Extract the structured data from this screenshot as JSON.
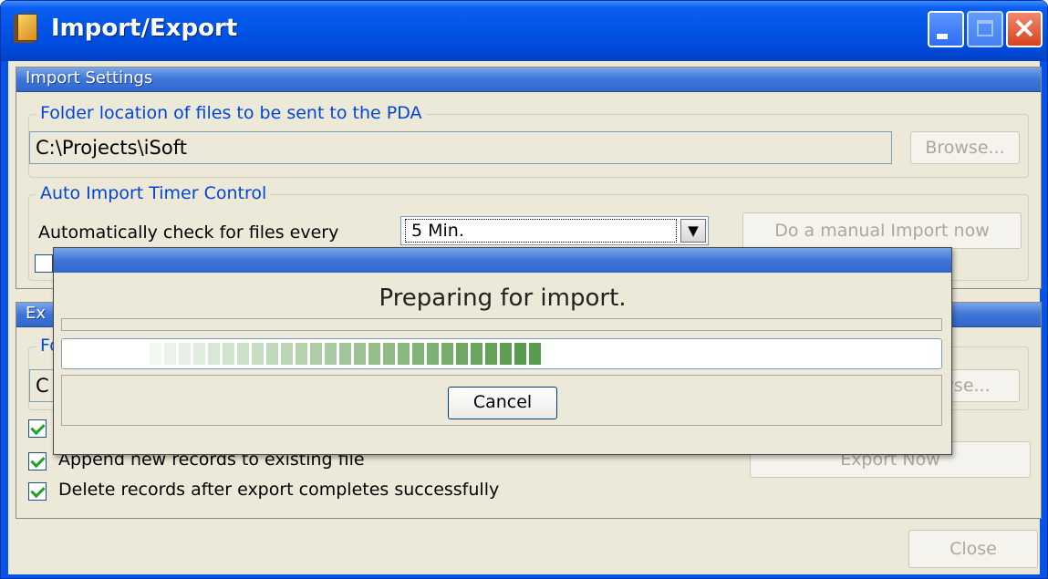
{
  "window": {
    "title": "Import/Export"
  },
  "import_settings": {
    "header": "Import Settings",
    "folder_group": {
      "legend": "Folder location of files to be sent to the PDA",
      "path_value": "C:\\Projects\\iSoft",
      "browse_label": "Browse..."
    },
    "timer_group": {
      "legend": "Auto Import Timer Control",
      "check_label": "Automatically check for files every",
      "interval_value": "5 Min.",
      "manual_import_label": "Do a manual Import now",
      "enable_checked": false
    }
  },
  "export_settings": {
    "header_visible_fragment": "Ex",
    "folder_legend_fragment": "Fo",
    "path_fragment": "C",
    "browse_fragment": "wse...",
    "options": [
      {
        "label": "",
        "checked": true
      },
      {
        "label": "Append new records to existing file",
        "checked": true
      },
      {
        "label": "Delete records after export completes successfully",
        "checked": true
      }
    ],
    "export_now_label": "Export Now"
  },
  "close_label": "Close",
  "progress_dialog": {
    "message": "Preparing for import.",
    "progress_percent": 45,
    "cancel_label": "Cancel",
    "accent_color": "#5a9a4c"
  },
  "colors": {
    "titlebar": "#0055e6",
    "panel_header": "#3d76d8",
    "legend_text": "#0046d5",
    "window_bg": "#ece9d8"
  }
}
